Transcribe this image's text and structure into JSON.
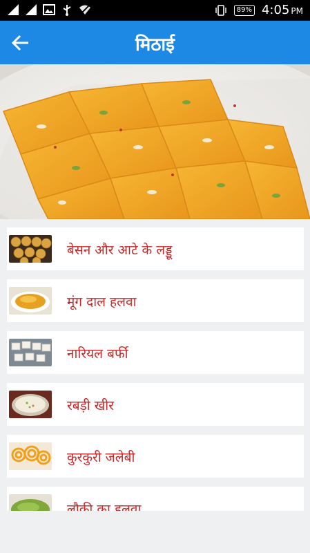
{
  "status_bar": {
    "battery": "89%",
    "time": "4:05",
    "ampm": "PM"
  },
  "app_bar": {
    "title": "मिठाई"
  },
  "hero": {
    "icon": "barfi-photo"
  },
  "recipes": [
    {
      "label": "बेसन और आटे के लड्डू",
      "icon": "laddu-thumbnail"
    },
    {
      "label": "मूंग दाल हलवा",
      "icon": "moong-dal-halwa-thumbnail"
    },
    {
      "label": "नारियल बर्फी",
      "icon": "coconut-barfi-thumbnail"
    },
    {
      "label": "रबड़ी खीर",
      "icon": "rabdi-kheer-thumbnail"
    },
    {
      "label": "कुरकुरी जलेबी",
      "icon": "jalebi-thumbnail"
    },
    {
      "label": "लौकी का हलवा",
      "icon": "lauki-halwa-thumbnail"
    }
  ]
}
